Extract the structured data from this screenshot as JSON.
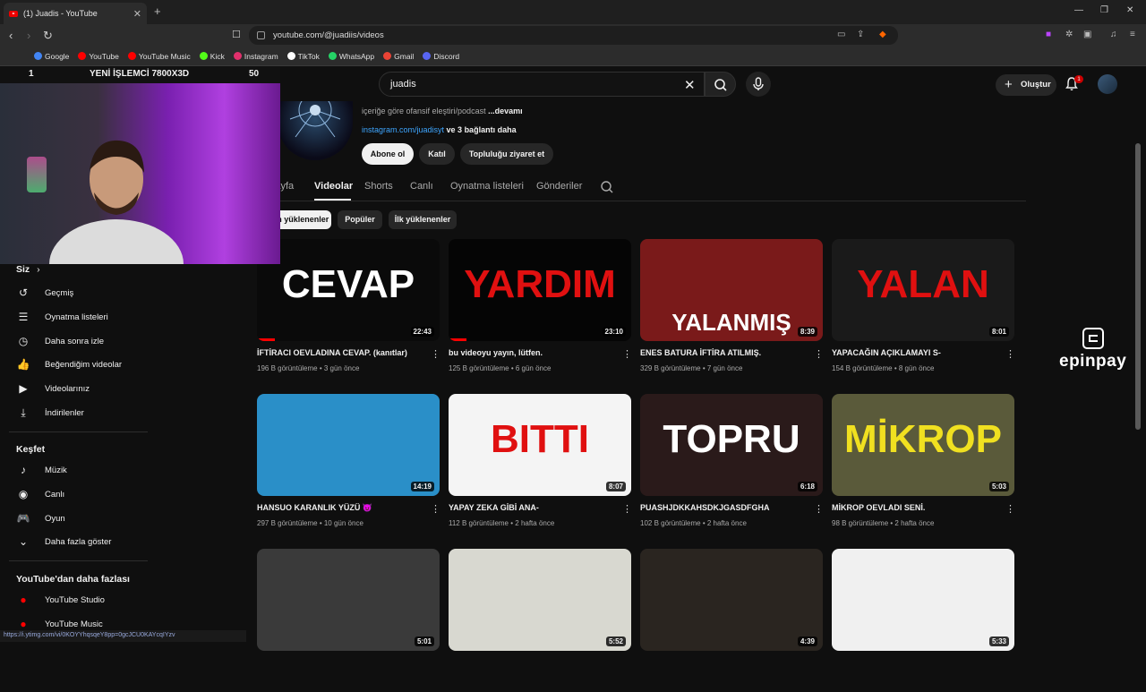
{
  "browser": {
    "tab_title": "(1) Juadis - YouTube",
    "url": "youtube.com/@juadiis/videos",
    "bookmarks": [
      {
        "label": "Google",
        "color": "#4285f4"
      },
      {
        "label": "YouTube",
        "color": "#ff0000"
      },
      {
        "label": "YouTube Music",
        "color": "#ff0000"
      },
      {
        "label": "Kick",
        "color": "#53fc18"
      },
      {
        "label": "Instagram",
        "color": "#e1306c"
      },
      {
        "label": "TikTok",
        "color": "#ffffff"
      },
      {
        "label": "WhatsApp",
        "color": "#25d366"
      },
      {
        "label": "Gmail",
        "color": "#ea4335"
      },
      {
        "label": "Discord",
        "color": "#5865f2"
      }
    ],
    "status_url": "https://i.ytimg.com/vi/0KOYYhqsqeY8pp=0gcJCU0KAYcqIYzv"
  },
  "youtube": {
    "search_value": "juadis",
    "create_label": "Oluştur",
    "notification_count": "1"
  },
  "channel": {
    "description": "içeriğe göre ofansif eleştiri/podcast",
    "more_label": "...devamı",
    "link": "instagram.com/juadisyt",
    "more_links": " ve 3 bağlantı daha",
    "subscribe_label": "Abone ol",
    "join_label": "Katıl",
    "community_label": "Topluluğu ziyaret et",
    "tabs": [
      "Sayfa",
      "Videolar",
      "Shorts",
      "Canlı",
      "Oynatma listeleri",
      "Gönderiler"
    ],
    "active_tab": "Videolar",
    "chips": [
      "En son yüklenenler",
      "Popüler",
      "İlk yüklenenler"
    ]
  },
  "webcam": {
    "banner_left": "1",
    "banner_text": "YENİ İŞLEMCİ 7800X3D",
    "banner_right": "50"
  },
  "sidebar": {
    "you_heading": "Siz",
    "you_items": [
      {
        "label": "Geçmiş",
        "icon": "history-icon"
      },
      {
        "label": "Oynatma listeleri",
        "icon": "playlist-icon"
      },
      {
        "label": "Daha sonra izle",
        "icon": "clock-icon"
      },
      {
        "label": "Beğendiğim videolar",
        "icon": "thumbs-up-icon"
      },
      {
        "label": "Videolarınız",
        "icon": "video-icon"
      },
      {
        "label": "İndirilenler",
        "icon": "download-icon"
      }
    ],
    "explore_heading": "Keşfet",
    "explore_items": [
      {
        "label": "Müzik",
        "icon": "music-icon"
      },
      {
        "label": "Canlı",
        "icon": "live-icon"
      },
      {
        "label": "Oyun",
        "icon": "gamepad-icon"
      },
      {
        "label": "Daha fazla göster",
        "icon": "chevron-down-icon"
      }
    ],
    "more_heading": "YouTube'dan daha fazlası",
    "more_items": [
      {
        "label": "YouTube Studio"
      },
      {
        "label": "YouTube Music"
      }
    ]
  },
  "videos": [
    {
      "title": "İFTİRACI OEVLADINA CEVAP. (kanıtlar)",
      "views": "196 B görüntüleme",
      "age": "3 gün önce",
      "duration": "22:43",
      "thumb_text": "CEVAP",
      "thumb_bg": "#0a0a0a",
      "thumb_fg": "#ffffff",
      "progress": 0.1
    },
    {
      "title": "bu videoyu yayın, lütfen.",
      "views": "125 B görüntüleme",
      "age": "6 gün önce",
      "duration": "23:10",
      "thumb_text": "YARDIM",
      "thumb_bg": "#050505",
      "thumb_fg": "#e01010",
      "progress": 0.1
    },
    {
      "title": "ENES BATURA İFTİRA ATILMIŞ.",
      "views": "329 B görüntüleme",
      "age": "7 gün önce",
      "duration": "8:39",
      "thumb_text": "YALANMIŞ",
      "thumb_bg": "#7a1a1a",
      "thumb_fg": "#ffffff",
      "progress": 0
    },
    {
      "title": "YAPACAĞIN AÇIKLAMAYI S-",
      "views": "154 B görüntüleme",
      "age": "8 gün önce",
      "duration": "8:01",
      "thumb_text": "YALAN",
      "thumb_bg": "#1a1a1a",
      "thumb_fg": "#e01010",
      "progress": 0
    },
    {
      "title": "HANSUO KARANLIK YÜZÜ 😈",
      "views": "297 B görüntüleme",
      "age": "10 gün önce",
      "duration": "14:19",
      "thumb_text": "",
      "thumb_bg": "#2a8fc8",
      "thumb_fg": "#ffffff",
      "progress": 0
    },
    {
      "title": "YAPAY ZEKA GİBİ ANA-",
      "views": "112 B görüntüleme",
      "age": "2 hafta önce",
      "duration": "8:07",
      "thumb_text": "BITTI",
      "thumb_bg": "#f4f4f4",
      "thumb_fg": "#e01010",
      "progress": 0
    },
    {
      "title": "PUASHJDKKAHSDKJGASDFGHA",
      "views": "102 B görüntüleme",
      "age": "2 hafta önce",
      "duration": "6:18",
      "thumb_text": "TOPRU",
      "thumb_bg": "#2a1a1a",
      "thumb_fg": "#ffffff",
      "progress": 0
    },
    {
      "title": "MİKROP OEVLADI SENİ.",
      "views": "98 B görüntüleme",
      "age": "2 hafta önce",
      "duration": "5:03",
      "thumb_text": "MİKROP",
      "thumb_bg": "#5a5a3a",
      "thumb_fg": "#f0e020",
      "progress": 0
    },
    {
      "title": "",
      "views": "",
      "age": "",
      "duration": "5:01",
      "thumb_text": "",
      "thumb_bg": "#3a3a3a",
      "thumb_fg": "#ffffff",
      "progress": 0
    },
    {
      "title": "",
      "views": "",
      "age": "",
      "duration": "5:52",
      "thumb_text": "",
      "thumb_bg": "#d8d8d0",
      "thumb_fg": "#ffffff",
      "progress": 0
    },
    {
      "title": "",
      "views": "",
      "age": "",
      "duration": "4:39",
      "thumb_text": "",
      "thumb_bg": "#2a2520",
      "thumb_fg": "#ffffff",
      "progress": 0
    },
    {
      "title": "",
      "views": "",
      "age": "",
      "duration": "5:33",
      "thumb_text": "",
      "thumb_bg": "#f0f0f0",
      "thumb_fg": "#ffffff",
      "progress": 0
    }
  ],
  "ad": {
    "brand": "epinpay"
  }
}
